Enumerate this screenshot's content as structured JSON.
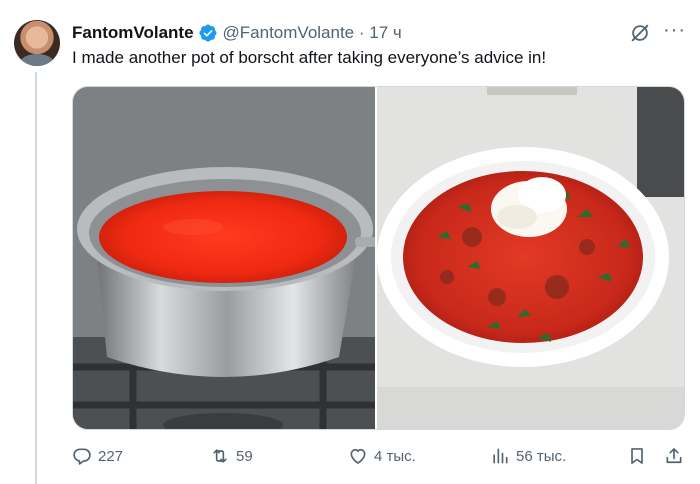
{
  "author": {
    "display_name": "FantomVolante",
    "handle": "@FantomVolante",
    "time": " · 17 ч",
    "verified": true
  },
  "tweet": {
    "text": "I made another pot of borscht after taking everyone’s advice in!"
  },
  "media": [
    {
      "icon": "photo-pot-of-borscht"
    },
    {
      "icon": "photo-bowl-of-borscht"
    }
  ],
  "stats": {
    "replies": "227",
    "retweets": "59",
    "likes": "4 тыс.",
    "views": "56 тыс."
  },
  "colors": {
    "verified": "#1d9bf0",
    "secondary_text": "#536471",
    "borscht_red": "#e8351f"
  }
}
